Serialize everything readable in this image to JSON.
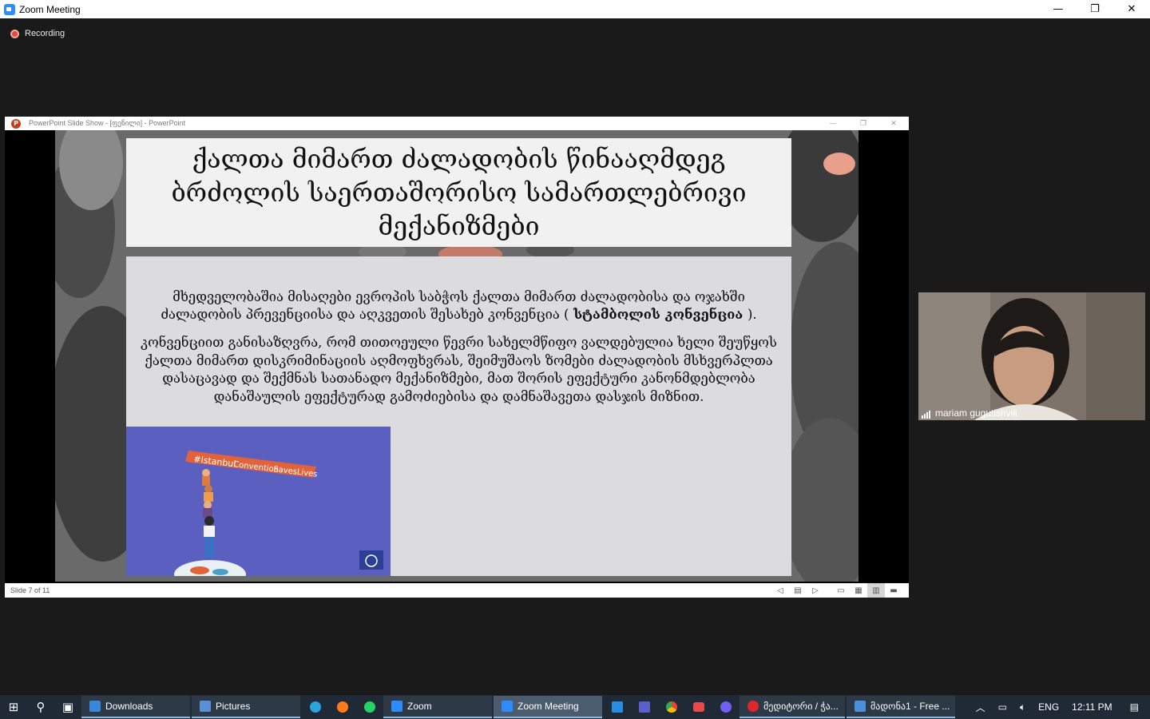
{
  "window": {
    "title": "Zoom Meeting",
    "controls": [
      "—",
      "❐",
      "✕"
    ]
  },
  "recording": {
    "label": "Recording"
  },
  "powerpoint": {
    "title": "PowerPoint Slide Show - [ფეწილი] - PowerPoint",
    "slide_counter": "Slide 7 of 11",
    "slide": {
      "title": "ქალთა მიმართ ძალადობის წინააღმდეგ ბრძოლის საერთაშორისო სამართლებრივი მექანიზმები",
      "para1_pre": "მხედველობაშია მისაღები ევროპის საბჭოს ქალთა მიმართ ძალადობისა და ოჯახში ძალადობის პრევენციისა და აღკვეთის შესახებ კონვენცია (",
      "para1_bold": " სტამბოლის კონვენცია ",
      "para1_post": ").",
      "para2": "კონვენციით განისაზღვრა, რომ თითოეული წევრი სახელმწიფო ვალდებულია ხელი შეუწყოს ქალთა მიმართ დისკრიმინაციის აღმოფხვრას, შეიმუშაოს ზომები ძალადობის მსხვერპლთა დასაცავად და შექმნას სათანადო მექანიზმები, მათ შორის ეფექტური კანონმდებლობა დანაშაულის ეფექტურად გამოძიებისა და დამნაშავეთა დასჯის მიზნით.",
      "poster_banner": [
        "#Istanbul",
        "Convention",
        "SavesLives"
      ]
    }
  },
  "participant": {
    "name": "mariam gugutishvili"
  },
  "taskbar": {
    "apps": [
      {
        "label": "Downloads",
        "color": "#3a86d8"
      },
      {
        "label": "Pictures",
        "color": "#5a8fd6"
      },
      {
        "label": "Zoom",
        "color": "#2d8cff"
      },
      {
        "label": "Zoom Meeting",
        "color": "#2d8cff"
      },
      {
        "label": "მედიტორი / ჭა...",
        "color": "#e0262b"
      },
      {
        "label": "მადონა1 - Free ...",
        "color": "#4a90d9"
      }
    ],
    "tray": {
      "lang": "ENG",
      "time": "12:11 PM"
    }
  }
}
